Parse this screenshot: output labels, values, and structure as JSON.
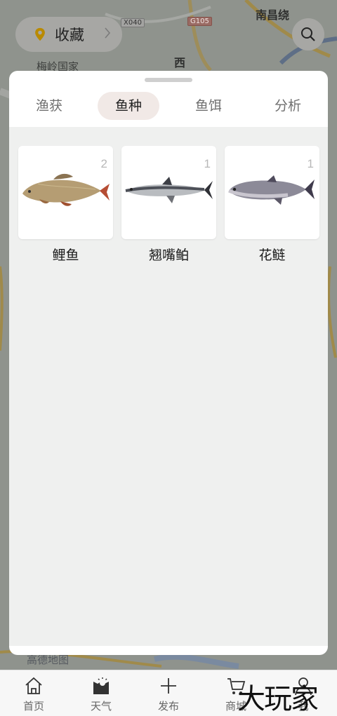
{
  "map": {
    "labels": [
      "南昌绕",
      "西",
      "梅岭国家",
      "高德地图"
    ],
    "road_tags": [
      "X040",
      "G105"
    ]
  },
  "favorites": {
    "label": "收藏"
  },
  "tabs": [
    {
      "label": "渔获",
      "active": false
    },
    {
      "label": "鱼种",
      "active": true
    },
    {
      "label": "鱼饵",
      "active": false
    },
    {
      "label": "分析",
      "active": false
    }
  ],
  "fish": [
    {
      "name": "鲤鱼",
      "count": "2",
      "icon": "carp-photo"
    },
    {
      "name": "翘嘴鲌",
      "count": "1",
      "icon": "topmouth-culter-photo"
    },
    {
      "name": "花鲢",
      "count": "1",
      "icon": "bighead-carp-photo"
    }
  ],
  "bottom_nav": [
    {
      "label": "首页",
      "icon": "home-icon"
    },
    {
      "label": "天气",
      "icon": "weather-icon"
    },
    {
      "label": "发布",
      "icon": "plus-icon"
    },
    {
      "label": "商城",
      "icon": "cart-icon"
    },
    {
      "label": "我",
      "icon": "user-icon"
    }
  ],
  "watermark": "大玩家",
  "colors": {
    "active_tab_bg": "#f1e9e6",
    "content_bg": "#eff0ef",
    "pin": "#b98a00"
  }
}
